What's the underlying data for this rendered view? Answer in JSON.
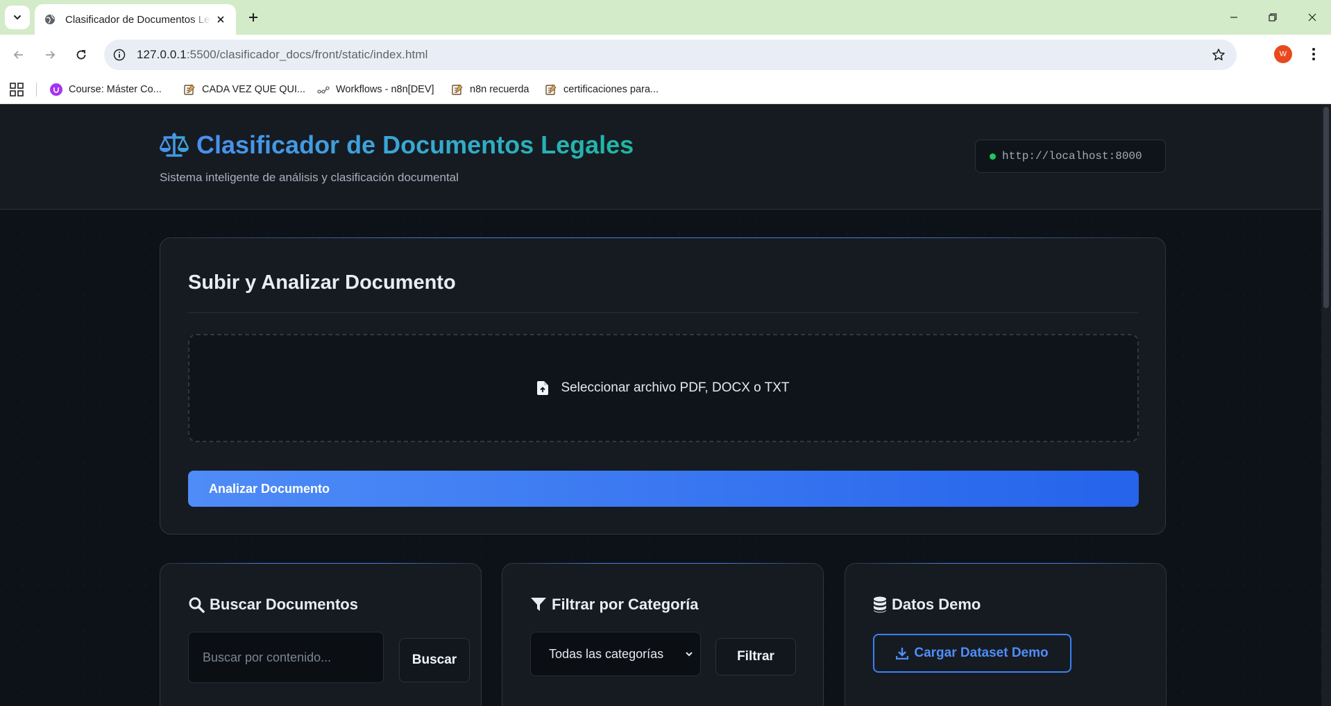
{
  "browser": {
    "tab_title": "Clasificador de Documentos Legales",
    "url_host": "127.0.0.1",
    "url_rest": ":5500/clasificador_docs/front/static/index.html",
    "profile_initial": "W",
    "bookmarks": [
      {
        "label": "Course: Máster Co...",
        "icon": "udemy-icon"
      },
      {
        "label": "CADA VEZ QUE QUI...",
        "icon": "note-icon"
      },
      {
        "label": "Workflows - n8n[DEV]",
        "icon": "n8n-icon"
      },
      {
        "label": "n8n recuerda",
        "icon": "note-icon"
      },
      {
        "label": "certificaciones para...",
        "icon": "note-icon"
      }
    ]
  },
  "header": {
    "title": "Clasificador de Documentos Legales",
    "subtitle": "Sistema inteligente de análisis y clasificación documental",
    "api_url": "http://localhost:8000",
    "api_status_color": "#22c55e"
  },
  "upload": {
    "title": "Subir y Analizar Documento",
    "dropzone_label": "Seleccionar archivo PDF, DOCX o TXT",
    "analyze_label": "Analizar Documento"
  },
  "search": {
    "title": "Buscar Documentos",
    "placeholder": "Buscar por contenido...",
    "button_label": "Buscar"
  },
  "filter": {
    "title": "Filtrar por Categoría",
    "selected": "Todas las categorías",
    "button_label": "Filtrar"
  },
  "demo": {
    "title": "Datos Demo",
    "button_label": "Cargar Dataset Demo"
  },
  "colors": {
    "accent": "#3b82f6",
    "title_gradient_start": "#4a8ff0",
    "title_gradient_end": "#1fb7a3",
    "background": "#0d1219"
  }
}
